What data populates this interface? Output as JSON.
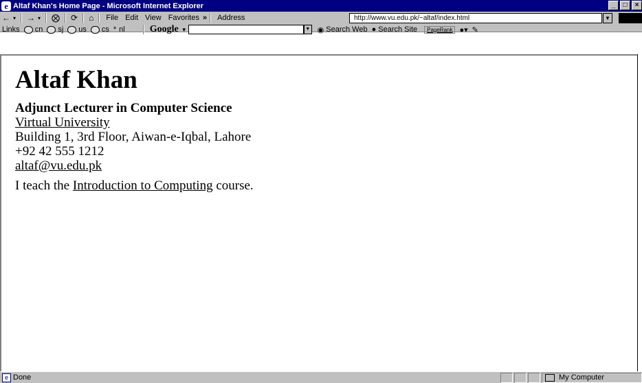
{
  "window": {
    "title": "Altaf Khan's Home Page - Microsoft Internet Explorer",
    "controls": [
      "_",
      "□",
      "×"
    ]
  },
  "menubar": {
    "file": "File",
    "edit": "Edit",
    "view": "View",
    "favorites": "Favorites",
    "more": "»",
    "address_label": "Address",
    "address_value": "http://www.vu.edu.pk/~altaf/index.html"
  },
  "links": {
    "label": "Links",
    "items": [
      "cn",
      "sj",
      "us",
      "cs",
      "nl"
    ]
  },
  "google": {
    "logo": "Google",
    "search_web": "Search Web",
    "search_site": "Search Site",
    "pagerank": "PageRank"
  },
  "page": {
    "name": "Altaf Khan",
    "position": "Adjunct Lecturer in Computer Science",
    "university": "Virtual University",
    "address": "Building 1, 3rd Floor, Aiwan-e-Iqbal, Lahore",
    "phone": "+92 42 555 1212",
    "email": "altaf@vu.edu.pk",
    "teach_prefix": "I teach the ",
    "course_link": "Introduction to Computing",
    "teach_suffix": " course."
  },
  "status": {
    "text": "Done",
    "zone": "My Computer"
  }
}
